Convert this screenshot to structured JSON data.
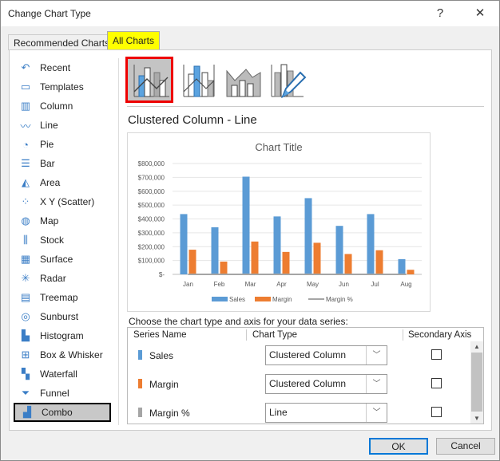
{
  "window": {
    "title": "Change Chart Type",
    "help": "?",
    "close": "✕"
  },
  "tabs": [
    {
      "label": "Recommended Charts"
    },
    {
      "label": "All Charts"
    }
  ],
  "sidebar": {
    "items": [
      {
        "label": "Recent",
        "icon": "recent-icon"
      },
      {
        "label": "Templates",
        "icon": "folder-icon"
      },
      {
        "label": "Column",
        "icon": "column-chart-icon"
      },
      {
        "label": "Line",
        "icon": "line-chart-icon"
      },
      {
        "label": "Pie",
        "icon": "pie-chart-icon"
      },
      {
        "label": "Bar",
        "icon": "bar-chart-icon"
      },
      {
        "label": "Area",
        "icon": "area-chart-icon"
      },
      {
        "label": "X Y (Scatter)",
        "icon": "scatter-chart-icon"
      },
      {
        "label": "Map",
        "icon": "map-icon"
      },
      {
        "label": "Stock",
        "icon": "stock-chart-icon"
      },
      {
        "label": "Surface",
        "icon": "surface-chart-icon"
      },
      {
        "label": "Radar",
        "icon": "radar-chart-icon"
      },
      {
        "label": "Treemap",
        "icon": "treemap-icon"
      },
      {
        "label": "Sunburst",
        "icon": "sunburst-icon"
      },
      {
        "label": "Histogram",
        "icon": "histogram-icon"
      },
      {
        "label": "Box & Whisker",
        "icon": "box-whisker-icon"
      },
      {
        "label": "Waterfall",
        "icon": "waterfall-icon"
      },
      {
        "label": "Funnel",
        "icon": "funnel-icon"
      },
      {
        "label": "Combo",
        "icon": "combo-chart-icon"
      }
    ]
  },
  "main": {
    "heading": "Clustered Column - Line",
    "series_prompt": "Choose the chart type and axis for your data series:",
    "headers": {
      "name": "Series Name",
      "type": "Chart Type",
      "axis": "Secondary Axis"
    },
    "series": [
      {
        "name": "Sales",
        "type": "Clustered Column",
        "color": "#5b9bd5",
        "secondary": false
      },
      {
        "name": "Margin",
        "type": "Clustered Column",
        "color": "#ed7d31",
        "secondary": false
      },
      {
        "name": "Margin %",
        "type": "Line",
        "color": "#a5a5a5",
        "secondary": false
      }
    ]
  },
  "chart_data": {
    "type": "bar",
    "title": "Chart Title",
    "categories": [
      "Jan",
      "Feb",
      "Mar",
      "Apr",
      "May",
      "Jun",
      "Jul",
      "Aug"
    ],
    "ylim": [
      0,
      800000
    ],
    "yticks": [
      "$-",
      "$100,000",
      "$200,000",
      "$300,000",
      "$400,000",
      "$500,000",
      "$600,000",
      "$700,000",
      "$800,000"
    ],
    "series": [
      {
        "name": "Sales",
        "color": "#5b9bd5",
        "values": [
          435000,
          340000,
          705000,
          418000,
          550000,
          350000,
          435000,
          110000
        ]
      },
      {
        "name": "Margin",
        "color": "#ed7d31",
        "values": [
          178000,
          92000,
          237000,
          162000,
          228000,
          147000,
          174000,
          33000
        ]
      },
      {
        "name": "Margin %",
        "color": "#a5a5a5",
        "type": "line",
        "values": [
          0.41,
          0.27,
          0.34,
          0.39,
          0.41,
          0.42,
          0.4,
          0.3
        ]
      }
    ],
    "legend": "bottom"
  },
  "buttons": {
    "ok": "OK",
    "cancel": "Cancel"
  }
}
